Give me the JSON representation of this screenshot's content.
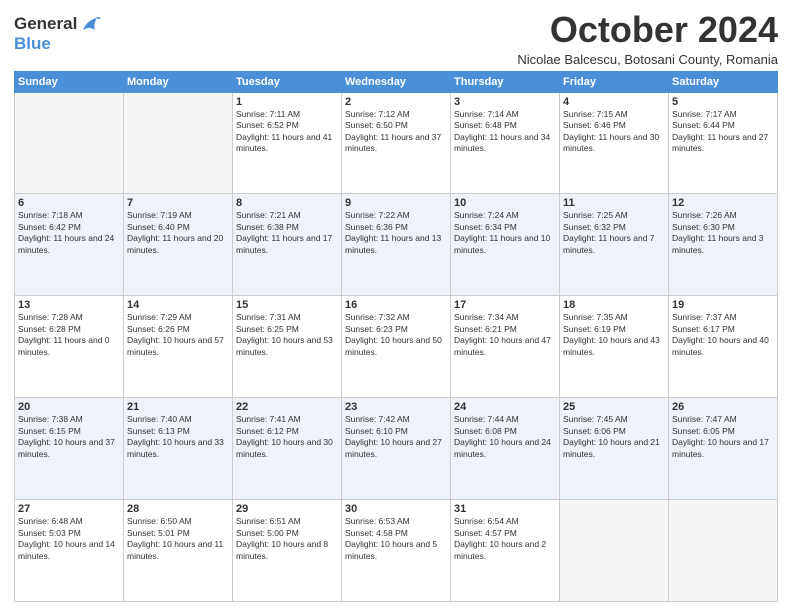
{
  "header": {
    "logo_line1": "General",
    "logo_line2": "Blue",
    "month": "October 2024",
    "location": "Nicolae Balcescu, Botosani County, Romania"
  },
  "days_of_week": [
    "Sunday",
    "Monday",
    "Tuesday",
    "Wednesday",
    "Thursday",
    "Friday",
    "Saturday"
  ],
  "weeks": [
    [
      {
        "day": "",
        "info": ""
      },
      {
        "day": "",
        "info": ""
      },
      {
        "day": "1",
        "info": "Sunrise: 7:11 AM\nSunset: 6:52 PM\nDaylight: 11 hours and 41 minutes."
      },
      {
        "day": "2",
        "info": "Sunrise: 7:12 AM\nSunset: 6:50 PM\nDaylight: 11 hours and 37 minutes."
      },
      {
        "day": "3",
        "info": "Sunrise: 7:14 AM\nSunset: 6:48 PM\nDaylight: 11 hours and 34 minutes."
      },
      {
        "day": "4",
        "info": "Sunrise: 7:15 AM\nSunset: 6:46 PM\nDaylight: 11 hours and 30 minutes."
      },
      {
        "day": "5",
        "info": "Sunrise: 7:17 AM\nSunset: 6:44 PM\nDaylight: 11 hours and 27 minutes."
      }
    ],
    [
      {
        "day": "6",
        "info": "Sunrise: 7:18 AM\nSunset: 6:42 PM\nDaylight: 11 hours and 24 minutes."
      },
      {
        "day": "7",
        "info": "Sunrise: 7:19 AM\nSunset: 6:40 PM\nDaylight: 11 hours and 20 minutes."
      },
      {
        "day": "8",
        "info": "Sunrise: 7:21 AM\nSunset: 6:38 PM\nDaylight: 11 hours and 17 minutes."
      },
      {
        "day": "9",
        "info": "Sunrise: 7:22 AM\nSunset: 6:36 PM\nDaylight: 11 hours and 13 minutes."
      },
      {
        "day": "10",
        "info": "Sunrise: 7:24 AM\nSunset: 6:34 PM\nDaylight: 11 hours and 10 minutes."
      },
      {
        "day": "11",
        "info": "Sunrise: 7:25 AM\nSunset: 6:32 PM\nDaylight: 11 hours and 7 minutes."
      },
      {
        "day": "12",
        "info": "Sunrise: 7:26 AM\nSunset: 6:30 PM\nDaylight: 11 hours and 3 minutes."
      }
    ],
    [
      {
        "day": "13",
        "info": "Sunrise: 7:28 AM\nSunset: 6:28 PM\nDaylight: 11 hours and 0 minutes."
      },
      {
        "day": "14",
        "info": "Sunrise: 7:29 AM\nSunset: 6:26 PM\nDaylight: 10 hours and 57 minutes."
      },
      {
        "day": "15",
        "info": "Sunrise: 7:31 AM\nSunset: 6:25 PM\nDaylight: 10 hours and 53 minutes."
      },
      {
        "day": "16",
        "info": "Sunrise: 7:32 AM\nSunset: 6:23 PM\nDaylight: 10 hours and 50 minutes."
      },
      {
        "day": "17",
        "info": "Sunrise: 7:34 AM\nSunset: 6:21 PM\nDaylight: 10 hours and 47 minutes."
      },
      {
        "day": "18",
        "info": "Sunrise: 7:35 AM\nSunset: 6:19 PM\nDaylight: 10 hours and 43 minutes."
      },
      {
        "day": "19",
        "info": "Sunrise: 7:37 AM\nSunset: 6:17 PM\nDaylight: 10 hours and 40 minutes."
      }
    ],
    [
      {
        "day": "20",
        "info": "Sunrise: 7:38 AM\nSunset: 6:15 PM\nDaylight: 10 hours and 37 minutes."
      },
      {
        "day": "21",
        "info": "Sunrise: 7:40 AM\nSunset: 6:13 PM\nDaylight: 10 hours and 33 minutes."
      },
      {
        "day": "22",
        "info": "Sunrise: 7:41 AM\nSunset: 6:12 PM\nDaylight: 10 hours and 30 minutes."
      },
      {
        "day": "23",
        "info": "Sunrise: 7:42 AM\nSunset: 6:10 PM\nDaylight: 10 hours and 27 minutes."
      },
      {
        "day": "24",
        "info": "Sunrise: 7:44 AM\nSunset: 6:08 PM\nDaylight: 10 hours and 24 minutes."
      },
      {
        "day": "25",
        "info": "Sunrise: 7:45 AM\nSunset: 6:06 PM\nDaylight: 10 hours and 21 minutes."
      },
      {
        "day": "26",
        "info": "Sunrise: 7:47 AM\nSunset: 6:05 PM\nDaylight: 10 hours and 17 minutes."
      }
    ],
    [
      {
        "day": "27",
        "info": "Sunrise: 6:48 AM\nSunset: 5:03 PM\nDaylight: 10 hours and 14 minutes."
      },
      {
        "day": "28",
        "info": "Sunrise: 6:50 AM\nSunset: 5:01 PM\nDaylight: 10 hours and 11 minutes."
      },
      {
        "day": "29",
        "info": "Sunrise: 6:51 AM\nSunset: 5:00 PM\nDaylight: 10 hours and 8 minutes."
      },
      {
        "day": "30",
        "info": "Sunrise: 6:53 AM\nSunset: 4:58 PM\nDaylight: 10 hours and 5 minutes."
      },
      {
        "day": "31",
        "info": "Sunrise: 6:54 AM\nSunset: 4:57 PM\nDaylight: 10 hours and 2 minutes."
      },
      {
        "day": "",
        "info": ""
      },
      {
        "day": "",
        "info": ""
      }
    ]
  ]
}
